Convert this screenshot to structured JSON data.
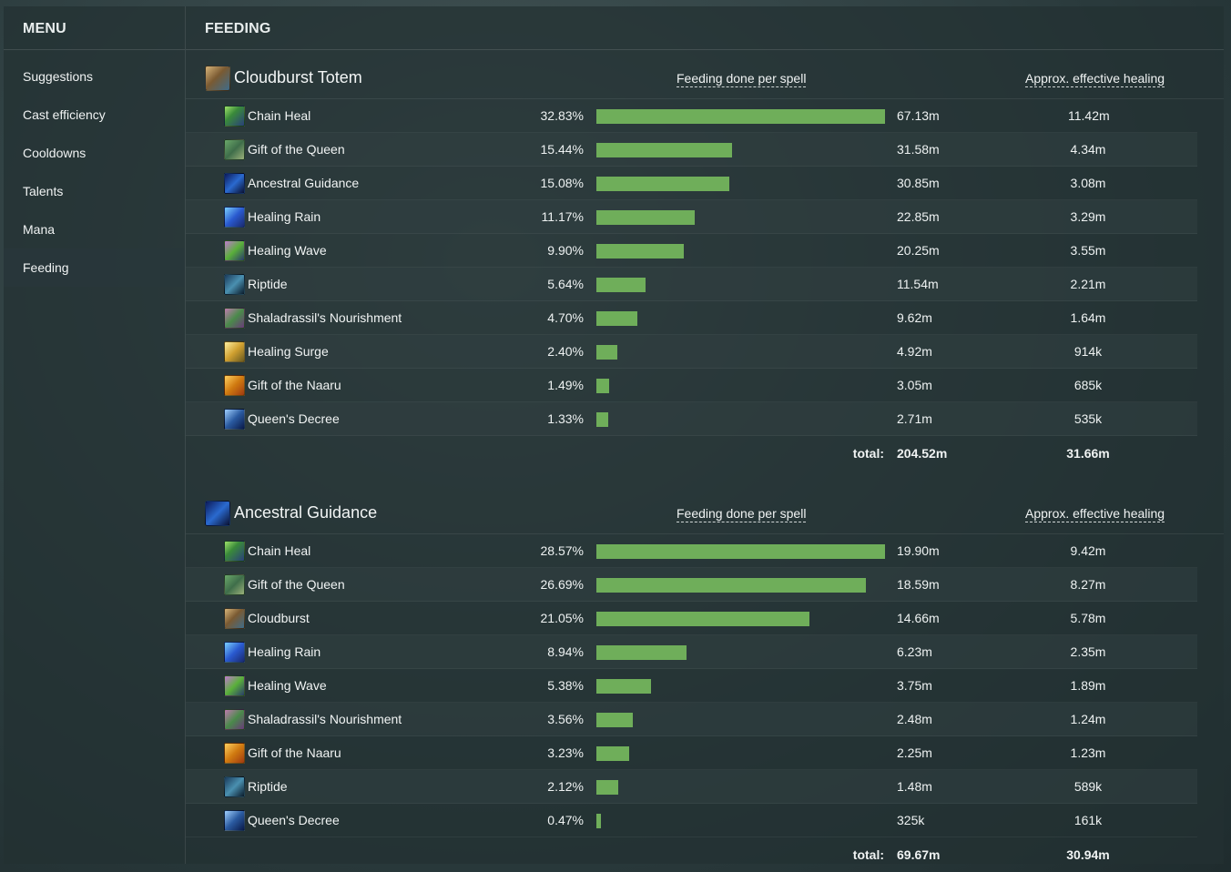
{
  "sidebar": {
    "header": "MENU",
    "items": [
      "Suggestions",
      "Cast efficiency",
      "Cooldowns",
      "Talents",
      "Mana",
      "Feeding"
    ],
    "active_index": 5
  },
  "main": {
    "header": "FEEDING",
    "column_feeding": "Feeding done per spell",
    "column_effective": "Approx. effective healing",
    "total_label": "total:",
    "bar_color": "#6fae5a",
    "blocks": [
      {
        "title": "Cloudburst Totem",
        "icon": "cloudburst-totem-icon",
        "rows": [
          {
            "name": "Chain Heal",
            "icon": "chain-heal-icon",
            "pct": "32.83%",
            "fraction": 0.3283,
            "amount": "67.13m",
            "effective": "11.42m"
          },
          {
            "name": "Gift of the Queen",
            "icon": "gift-of-the-queen-icon",
            "pct": "15.44%",
            "fraction": 0.1544,
            "amount": "31.58m",
            "effective": "4.34m"
          },
          {
            "name": "Ancestral Guidance",
            "icon": "ancestral-guidance-icon",
            "pct": "15.08%",
            "fraction": 0.1508,
            "amount": "30.85m",
            "effective": "3.08m"
          },
          {
            "name": "Healing Rain",
            "icon": "healing-rain-icon",
            "pct": "11.17%",
            "fraction": 0.1117,
            "amount": "22.85m",
            "effective": "3.29m"
          },
          {
            "name": "Healing Wave",
            "icon": "healing-wave-icon",
            "pct": "9.90%",
            "fraction": 0.099,
            "amount": "20.25m",
            "effective": "3.55m"
          },
          {
            "name": "Riptide",
            "icon": "riptide-icon",
            "pct": "5.64%",
            "fraction": 0.0564,
            "amount": "11.54m",
            "effective": "2.21m"
          },
          {
            "name": "Shaladrassil's Nourishment",
            "icon": "shaladrassils-nourishment-icon",
            "pct": "4.70%",
            "fraction": 0.047,
            "amount": "9.62m",
            "effective": "1.64m"
          },
          {
            "name": "Healing Surge",
            "icon": "healing-surge-icon",
            "pct": "2.40%",
            "fraction": 0.024,
            "amount": "4.92m",
            "effective": "914k"
          },
          {
            "name": "Gift of the Naaru",
            "icon": "gift-of-the-naaru-icon",
            "pct": "1.49%",
            "fraction": 0.0149,
            "amount": "3.05m",
            "effective": "685k"
          },
          {
            "name": "Queen's Decree",
            "icon": "queens-decree-icon",
            "pct": "1.33%",
            "fraction": 0.0133,
            "amount": "2.71m",
            "effective": "535k"
          }
        ],
        "total_amount": "204.52m",
        "total_effective": "31.66m"
      },
      {
        "title": "Ancestral Guidance",
        "icon": "ancestral-guidance-icon",
        "rows": [
          {
            "name": "Chain Heal",
            "icon": "chain-heal-icon",
            "pct": "28.57%",
            "fraction": 0.2857,
            "amount": "19.90m",
            "effective": "9.42m"
          },
          {
            "name": "Gift of the Queen",
            "icon": "gift-of-the-queen-icon",
            "pct": "26.69%",
            "fraction": 0.2669,
            "amount": "18.59m",
            "effective": "8.27m"
          },
          {
            "name": "Cloudburst",
            "icon": "cloudburst-totem-icon",
            "pct": "21.05%",
            "fraction": 0.2105,
            "amount": "14.66m",
            "effective": "5.78m"
          },
          {
            "name": "Healing Rain",
            "icon": "healing-rain-icon",
            "pct": "8.94%",
            "fraction": 0.0894,
            "amount": "6.23m",
            "effective": "2.35m"
          },
          {
            "name": "Healing Wave",
            "icon": "healing-wave-icon",
            "pct": "5.38%",
            "fraction": 0.0538,
            "amount": "3.75m",
            "effective": "1.89m"
          },
          {
            "name": "Shaladrassil's Nourishment",
            "icon": "shaladrassils-nourishment-icon",
            "pct": "3.56%",
            "fraction": 0.0356,
            "amount": "2.48m",
            "effective": "1.24m"
          },
          {
            "name": "Gift of the Naaru",
            "icon": "gift-of-the-naaru-icon",
            "pct": "3.23%",
            "fraction": 0.0323,
            "amount": "2.25m",
            "effective": "1.23m"
          },
          {
            "name": "Riptide",
            "icon": "riptide-icon",
            "pct": "2.12%",
            "fraction": 0.0212,
            "amount": "1.48m",
            "effective": "589k"
          },
          {
            "name": "Queen's Decree",
            "icon": "queens-decree-icon",
            "pct": "0.47%",
            "fraction": 0.0047,
            "amount": "325k",
            "effective": "161k"
          }
        ],
        "total_amount": "69.67m",
        "total_effective": "30.94m"
      }
    ]
  }
}
